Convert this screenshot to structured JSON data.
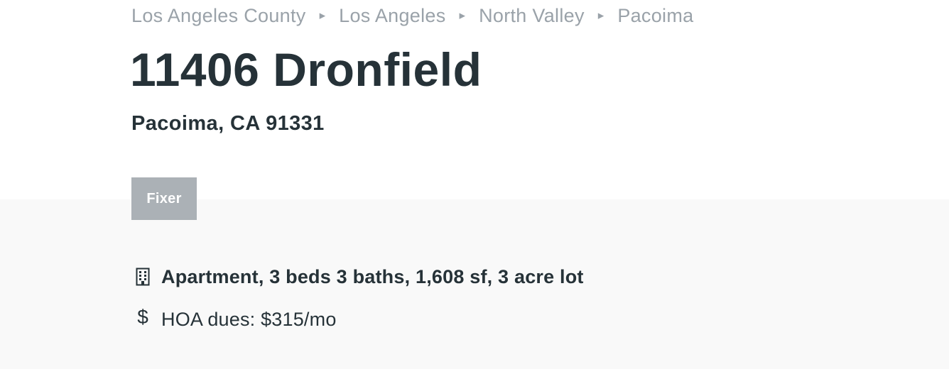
{
  "breadcrumb": {
    "items": [
      {
        "label": "Los Angeles County"
      },
      {
        "label": "Los Angeles"
      },
      {
        "label": "North Valley"
      },
      {
        "label": "Pacoima"
      }
    ],
    "separator": "▸"
  },
  "listing": {
    "title": "11406 Dronfield",
    "subtitle": "Pacoima, CA 91331",
    "tag": "Fixer"
  },
  "facts": [
    {
      "icon": "building-icon",
      "text": "Apartment, 3 beds 3 baths, 1,608 sf, 3 acre lot"
    },
    {
      "icon": "dollar-icon",
      "text": "HOA dues: $315/mo"
    }
  ],
  "colors": {
    "text": "#263238",
    "breadcrumb": "#9aa2a9",
    "tag_bg": "#abb1b6",
    "section_bg": "#f9f9f9"
  }
}
